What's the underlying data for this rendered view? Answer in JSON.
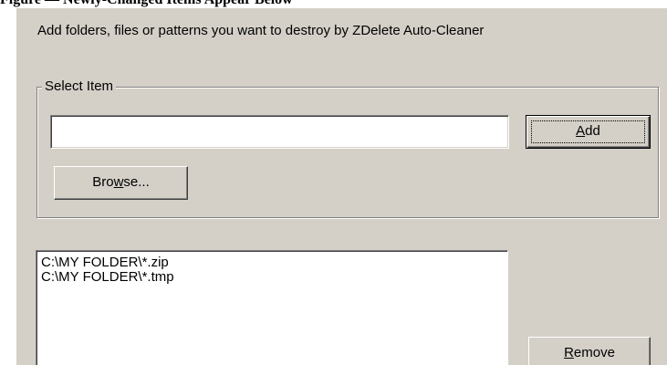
{
  "caption": "Figure — Newly-Changed Items Appear Below",
  "dialog": {
    "description": "Add folders, files or patterns you want to destroy by ZDelete Auto-Cleaner",
    "select_group": {
      "legend": "Select Item",
      "input_value": "",
      "add_button": {
        "pre": "",
        "accel": "A",
        "post": "dd"
      },
      "browse_button": {
        "pre": "Bro",
        "accel": "w",
        "post": "se..."
      }
    },
    "items": [
      "C:\\MY FOLDER\\*.zip",
      "C:\\MY FOLDER\\*.tmp"
    ],
    "remove_button": {
      "pre": "",
      "accel": "R",
      "post": "emove"
    }
  }
}
